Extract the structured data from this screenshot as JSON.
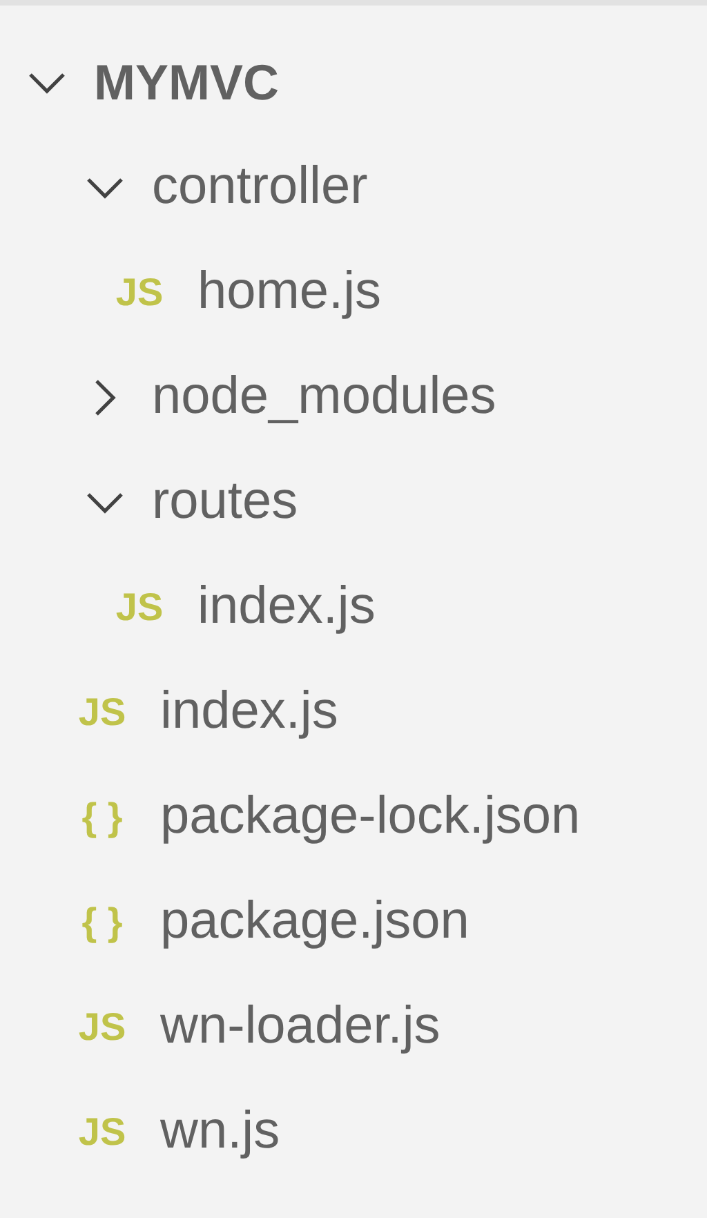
{
  "explorer": {
    "root": {
      "kind": "folder",
      "name": "MYMVC",
      "expanded": true,
      "children": [
        {
          "kind": "folder",
          "name": "controller",
          "expanded": true,
          "children": [
            {
              "kind": "file",
              "icon": "JS",
              "name": "home.js"
            }
          ]
        },
        {
          "kind": "folder",
          "name": "node_modules",
          "expanded": false
        },
        {
          "kind": "folder",
          "name": "routes",
          "expanded": true,
          "children": [
            {
              "kind": "file",
              "icon": "JS",
              "name": "index.js"
            }
          ]
        },
        {
          "kind": "file",
          "icon": "JS",
          "name": "index.js"
        },
        {
          "kind": "file",
          "icon": "{ }",
          "name": "package-lock.json"
        },
        {
          "kind": "file",
          "icon": "{ }",
          "name": "package.json"
        },
        {
          "kind": "file",
          "icon": "JS",
          "name": "wn-loader.js"
        },
        {
          "kind": "file",
          "icon": "JS",
          "name": "wn.js"
        }
      ]
    }
  }
}
